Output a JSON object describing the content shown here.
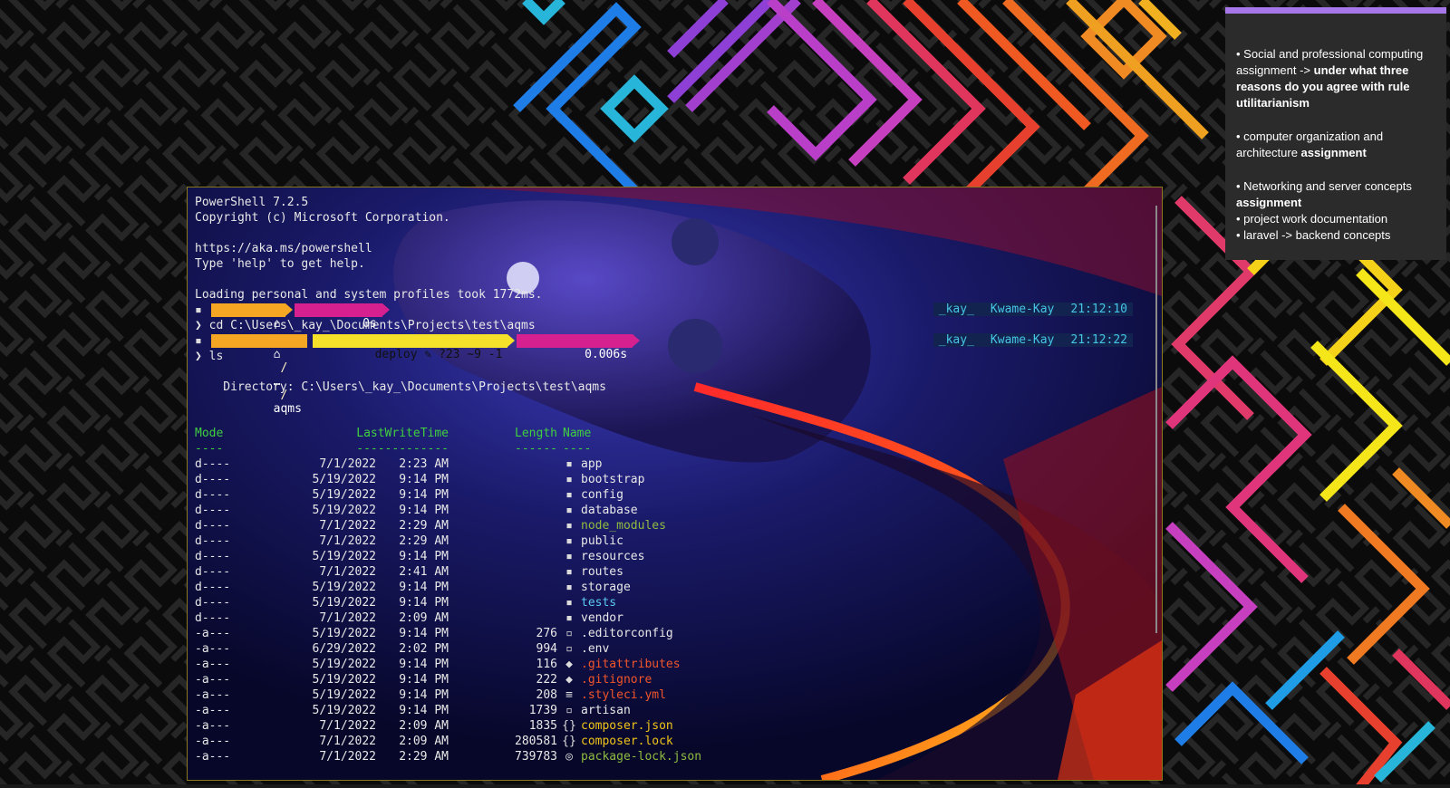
{
  "terminal": {
    "banner": [
      "PowerShell 7.2.5",
      "Copyright (c) Microsoft Corporation.",
      "",
      "https://aka.ms/powershell",
      "Type 'help' to get help.",
      "",
      "Loading personal and system profiles took 1772ms."
    ],
    "prompt1": {
      "home_icon": "⌂",
      "duration": "0s",
      "right_user": "_kay_",
      "right_host": "Kwame-Kay",
      "right_time": "21:12:10",
      "command": "cd C:\\Users\\_kay_\\Documents\\Projects\\test\\aqms"
    },
    "prompt2": {
      "home_icon": "⌂",
      "ellipsis": "…",
      "folder": "aqms",
      "git": "deploy ✎ ?23 ~9 -1",
      "duration": "0.006s",
      "right_user": "_kay_",
      "right_host": "Kwame-Kay",
      "right_time": "21:12:22",
      "command": "ls"
    },
    "prompt_char": "❯",
    "directory_label": "    Directory: C:\\Users\\_kay_\\Documents\\Projects\\test\\aqms",
    "headers": {
      "mode": "Mode",
      "lastwrite": "LastWriteTime",
      "length": "Length",
      "name": "Name"
    },
    "underlines": {
      "mode": "----",
      "lastwrite": "-------------",
      "length": "------",
      "name": "----"
    },
    "rows": [
      {
        "mode": "d----",
        "date": "7/1/2022",
        "time": "2:23 AM",
        "len": "",
        "icon": "▪",
        "name": "app",
        "color": "#e8e8e8"
      },
      {
        "mode": "d----",
        "date": "5/19/2022",
        "time": "9:14 PM",
        "len": "",
        "icon": "▪",
        "name": "bootstrap",
        "color": "#e8e8e8"
      },
      {
        "mode": "d----",
        "date": "5/19/2022",
        "time": "9:14 PM",
        "len": "",
        "icon": "▪",
        "name": "config",
        "color": "#e8e8e8"
      },
      {
        "mode": "d----",
        "date": "5/19/2022",
        "time": "9:14 PM",
        "len": "",
        "icon": "▪",
        "name": "database",
        "color": "#e8e8e8"
      },
      {
        "mode": "d----",
        "date": "7/1/2022",
        "time": "2:29 AM",
        "len": "",
        "icon": "▪",
        "name": "node_modules",
        "color": "#8fbc3f"
      },
      {
        "mode": "d----",
        "date": "7/1/2022",
        "time": "2:29 AM",
        "len": "",
        "icon": "▪",
        "name": "public",
        "color": "#e8e8e8"
      },
      {
        "mode": "d----",
        "date": "5/19/2022",
        "time": "9:14 PM",
        "len": "",
        "icon": "▪",
        "name": "resources",
        "color": "#e8e8e8"
      },
      {
        "mode": "d----",
        "date": "7/1/2022",
        "time": "2:41 AM",
        "len": "",
        "icon": "▪",
        "name": "routes",
        "color": "#e8e8e8"
      },
      {
        "mode": "d----",
        "date": "5/19/2022",
        "time": "9:14 PM",
        "len": "",
        "icon": "▪",
        "name": "storage",
        "color": "#e8e8e8"
      },
      {
        "mode": "d----",
        "date": "5/19/2022",
        "time": "9:14 PM",
        "len": "",
        "icon": "▪",
        "name": "tests",
        "color": "#5cc8f0"
      },
      {
        "mode": "d----",
        "date": "7/1/2022",
        "time": "2:09 AM",
        "len": "",
        "icon": "▪",
        "name": "vendor",
        "color": "#e8e8e8"
      },
      {
        "mode": "-a---",
        "date": "5/19/2022",
        "time": "9:14 PM",
        "len": "276",
        "icon": "▫",
        "name": ".editorconfig",
        "color": "#e8e8e8"
      },
      {
        "mode": "-a---",
        "date": "6/29/2022",
        "time": "2:02 PM",
        "len": "994",
        "icon": "▫",
        "name": ".env",
        "color": "#e8e8e8"
      },
      {
        "mode": "-a---",
        "date": "5/19/2022",
        "time": "9:14 PM",
        "len": "116",
        "icon": "◆",
        "name": ".gitattributes",
        "color": "#f0552a"
      },
      {
        "mode": "-a---",
        "date": "5/19/2022",
        "time": "9:14 PM",
        "len": "222",
        "icon": "◆",
        "name": ".gitignore",
        "color": "#f0552a"
      },
      {
        "mode": "-a---",
        "date": "5/19/2022",
        "time": "9:14 PM",
        "len": "208",
        "icon": "≡",
        "name": ".styleci.yml",
        "color": "#f0552a"
      },
      {
        "mode": "-a---",
        "date": "5/19/2022",
        "time": "9:14 PM",
        "len": "1739",
        "icon": "▫",
        "name": "artisan",
        "color": "#e8e8e8"
      },
      {
        "mode": "-a---",
        "date": "7/1/2022",
        "time": "2:09 AM",
        "len": "1835",
        "icon": "{}",
        "name": "composer.json",
        "color": "#f0c419"
      },
      {
        "mode": "-a---",
        "date": "7/1/2022",
        "time": "2:09 AM",
        "len": "280581",
        "icon": "{}",
        "name": "composer.lock",
        "color": "#f0c419"
      },
      {
        "mode": "-a---",
        "date": "7/1/2022",
        "time": "2:29 AM",
        "len": "739783",
        "icon": "◎",
        "name": "package-lock.json",
        "color": "#8fbc3f"
      }
    ]
  },
  "sticky_note": {
    "item1_plain": "• Social and professional computing assignment -> ",
    "item1_bold": "under what three reasons do you agree with rule utilitarianism",
    "item2_plain": "• computer organization and architecture ",
    "item2_bold": "assignment",
    "item3_plain": "• Networking and server concepts ",
    "item3_bold": "assignment",
    "item4": "• project work documentation",
    "item5": "• laravel -> backend concepts",
    "accent": "#a677e8"
  },
  "colors": {
    "prompt_home": "#f5a623",
    "prompt_path": "#f5a623",
    "prompt_git": "#f5e02a",
    "prompt_time": "#d6208f",
    "header_green": "#3fcf3f"
  }
}
